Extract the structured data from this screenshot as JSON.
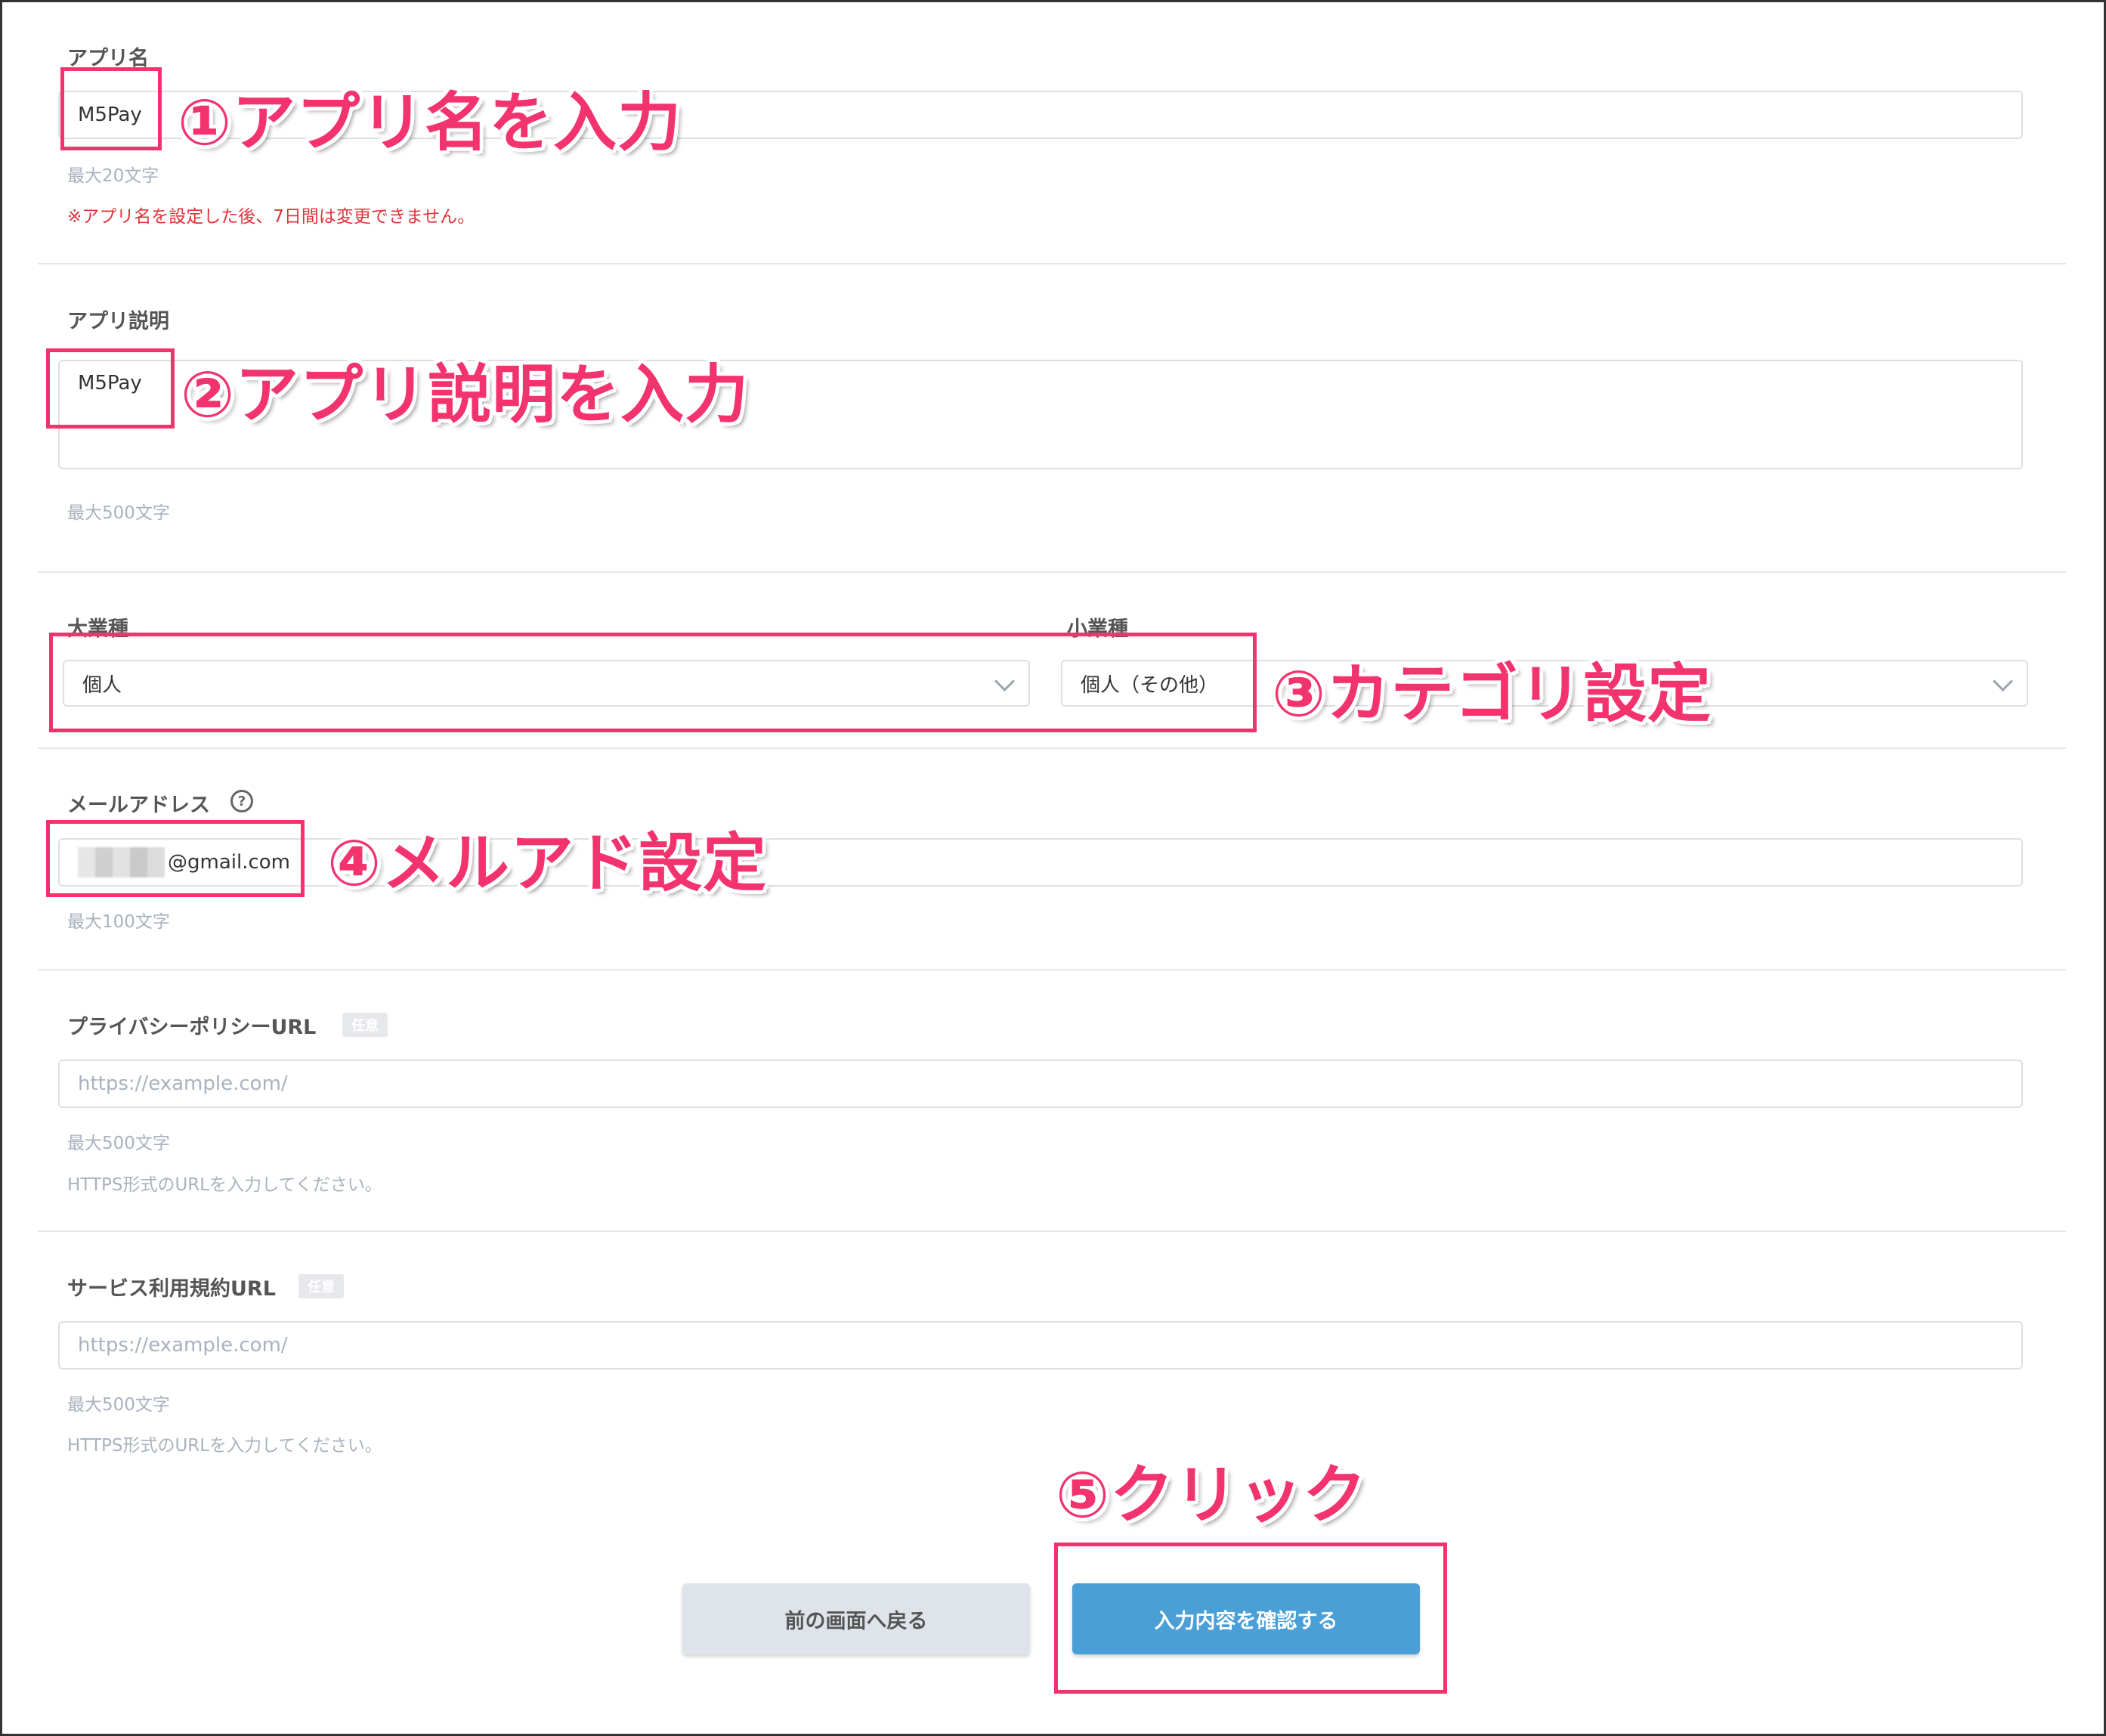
{
  "app_name": {
    "label": "アプリ名",
    "value": "M5Pay",
    "hint": "最大20文字",
    "warning": "※アプリ名を設定した後、7日間は変更できません。"
  },
  "app_description": {
    "label": "アプリ説明",
    "value": "M5Pay",
    "hint": "最大500文字"
  },
  "category": {
    "major_label": "大業種",
    "major_value": "個人",
    "minor_label": "小業種",
    "minor_value": "個人（その他）"
  },
  "email": {
    "label": "メールアドレス",
    "help_icon": "?",
    "value_suffix": "@gmail.com",
    "hint": "最大100文字"
  },
  "privacy_url": {
    "label": "プライバシーポリシーURL",
    "badge": "任意",
    "placeholder": "https://example.com/",
    "hint": "最大500文字",
    "hint2": "HTTPS形式のURLを入力してください。"
  },
  "terms_url": {
    "label": "サービス利用規約URL",
    "badge": "任意",
    "placeholder": "https://example.com/",
    "hint": "最大500文字",
    "hint2": "HTTPS形式のURLを入力してください。"
  },
  "buttons": {
    "back": "前の画面へ戻る",
    "confirm": "入力内容を確認する"
  },
  "annotations": {
    "step1": "①アプリ名を入力",
    "step2": "②アプリ説明を入力",
    "step3": "③カテゴリ設定",
    "step4": "④メルアド設定",
    "step5": "⑤クリック"
  },
  "colors": {
    "annotation_pink": "#f2336e",
    "confirm_blue": "#4a9fd6",
    "warning_red": "#e0343a"
  }
}
